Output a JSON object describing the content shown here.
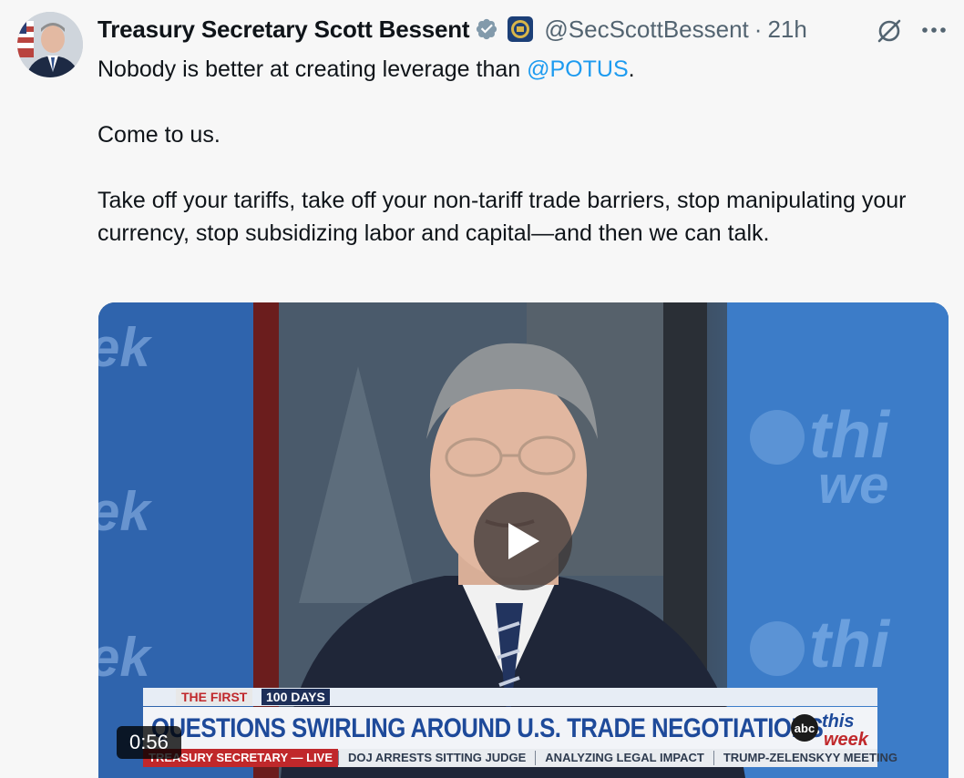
{
  "tweet": {
    "author_name": "Treasury Secretary Scott Bessent",
    "handle": "@SecScottBessent",
    "separator": "·",
    "time": "21h",
    "text_before_mention": "Nobody is better at creating leverage than ",
    "mention": "@POTUS",
    "text_after_mention": ".\n\nCome to us.\n\nTake off your tariffs, take off your non-tariff trade barriers, stop manipulating your currency, stop subsidizing labor and capital—and then we can talk."
  },
  "icons": {
    "verified": "verified-badge-icon",
    "affiliation": "treasury-seal-icon",
    "grok": "grok-icon",
    "more": "more-options-icon",
    "play": "play-icon"
  },
  "video": {
    "duration": "0:56",
    "lower_third_tag": "THE FIRST",
    "lower_third_days": "100 DAYS",
    "headline": "QUESTIONS SWIRLING AROUND U.S. TRADE NEGOTIATIONS",
    "network_logo_text": "abc",
    "show_logo_text_1": "this",
    "show_logo_text_2": "week",
    "ticker": [
      "TREASURY SECRETARY — LIVE",
      "DOJ ARRESTS SITTING JUDGE",
      "ANALYZING LEGAL IMPACT",
      "TRUMP-ZELENSKYY MEETING"
    ]
  },
  "colors": {
    "link": "#1d9bf0",
    "verified": "#829aab",
    "muted_text": "#536471",
    "headline_blue": "#1e4a9a",
    "alert_red": "#c0282b"
  }
}
